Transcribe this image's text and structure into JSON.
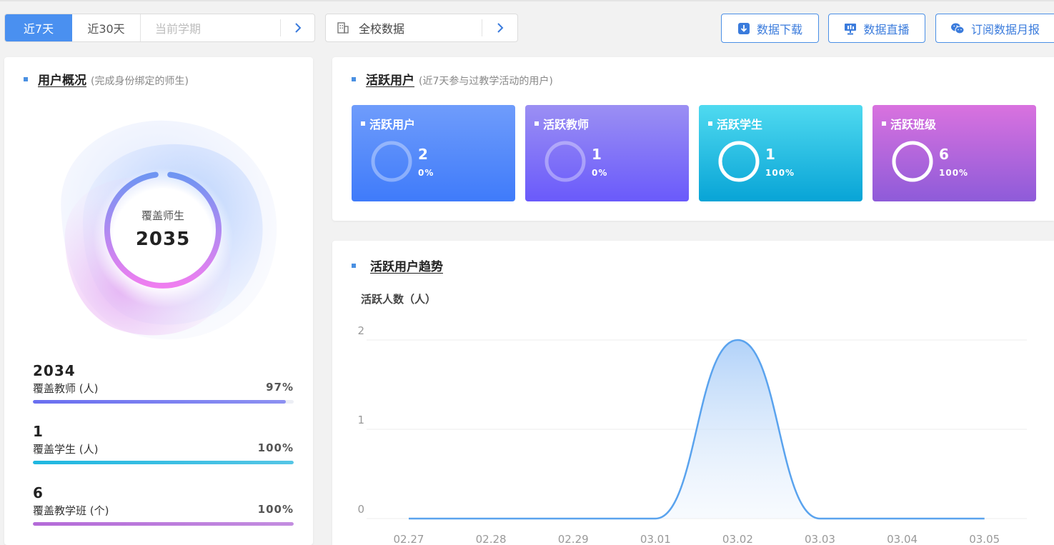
{
  "filters": {
    "range_options": [
      "近7天",
      "近30天"
    ],
    "term_placeholder": "当前学期",
    "scope_label": "全校数据"
  },
  "toolbar": {
    "download_label": "数据下载",
    "live_label": "数据直播",
    "subscribe_label": "订阅数据月报"
  },
  "overview": {
    "title": "用户概况",
    "subtitle": "(完成身份绑定的师生)",
    "center_label": "覆盖师生",
    "center_value": "2035",
    "stats": [
      {
        "value": "2034",
        "label": "覆盖教师 (人)",
        "percent": "97%",
        "fill": 0.97,
        "color": "#6a6ff0"
      },
      {
        "value": "1",
        "label": "覆盖学生 (人)",
        "percent": "100%",
        "fill": 1.0,
        "color": "#1fb7e0"
      },
      {
        "value": "6",
        "label": "覆盖教学班 (个)",
        "percent": "100%",
        "fill": 1.0,
        "color": "#b46ad8"
      }
    ]
  },
  "active": {
    "title": "活跃用户",
    "subtitle": "(近7天参与过教学活动的用户)",
    "tiles": [
      {
        "label": "活跃用户",
        "value": "2",
        "percent": "0%",
        "ratio": 0
      },
      {
        "label": "活跃教师",
        "value": "1",
        "percent": "0%",
        "ratio": 0
      },
      {
        "label": "活跃学生",
        "value": "1",
        "percent": "100%",
        "ratio": 1
      },
      {
        "label": "活跃班级",
        "value": "6",
        "percent": "100%",
        "ratio": 1
      }
    ]
  },
  "trend": {
    "title": "活跃用户趋势",
    "y_axis_title": "活跃人数（人）"
  },
  "chart_data": {
    "type": "area",
    "title": "",
    "xlabel": "",
    "ylabel": "活跃人数（人）",
    "categories": [
      "02.27",
      "02.28",
      "02.29",
      "03.01",
      "03.02",
      "03.03",
      "03.04",
      "03.05"
    ],
    "series": [
      {
        "values": [
          0,
          0,
          0,
          0,
          2,
          0,
          0,
          0
        ]
      }
    ],
    "yticks": [
      0,
      1,
      2
    ],
    "ylim": [
      0,
      2
    ],
    "grid": true,
    "smooth": true,
    "color": "#5aa3ee"
  }
}
